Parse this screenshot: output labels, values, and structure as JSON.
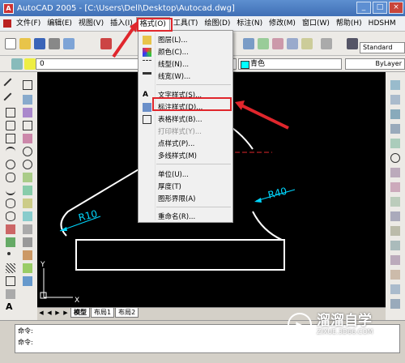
{
  "window": {
    "title": "AutoCAD 2005 - [C:\\Users\\Dell\\Desktop\\Autocad.dwg]",
    "controls": [
      "_",
      "□",
      "×"
    ]
  },
  "menubar": {
    "items": [
      "文件(F)",
      "编辑(E)",
      "视图(V)",
      "插入(I)",
      "格式(O)",
      "工具(T)",
      "绘图(D)",
      "标注(N)",
      "修改(M)",
      "窗口(W)",
      "帮助(H)",
      "HDSHM"
    ],
    "active_index": 4
  },
  "toolbar": {
    "style_value": "Standard",
    "layer_value": "0",
    "color_value": "青色",
    "linetype_value": "ByLayer"
  },
  "format_menu": {
    "items": [
      {
        "label": "图层(L)...",
        "enabled": true
      },
      {
        "label": "颜色(C)...",
        "enabled": true
      },
      {
        "label": "线型(N)...",
        "enabled": true
      },
      {
        "label": "线宽(W)...",
        "enabled": true
      },
      {
        "label": "文字样式(S)...",
        "enabled": true
      },
      {
        "label": "标注样式(D)...",
        "enabled": true
      },
      {
        "label": "表格样式(B)...",
        "enabled": true
      },
      {
        "label": "打印样式(Y)...",
        "enabled": false
      },
      {
        "label": "点样式(P)...",
        "enabled": true
      },
      {
        "label": "多线样式(M)",
        "enabled": true
      },
      {
        "label": "单位(U)...",
        "enabled": true
      },
      {
        "label": "厚度(T)",
        "enabled": true
      },
      {
        "label": "图形界限(A)",
        "enabled": true
      },
      {
        "label": "重命名(R)...",
        "enabled": true
      }
    ],
    "highlighted_index": 5
  },
  "drawing": {
    "dim_left": "R10",
    "dim_right": "R40",
    "ucs_x": "X",
    "ucs_y": "Y"
  },
  "layout_tabs": {
    "items": [
      "模型",
      "布局1",
      "布局2"
    ],
    "active_index": 0
  },
  "command": {
    "lines": [
      "命令:",
      "命令:"
    ]
  },
  "watermark": {
    "name": "溜溜自学",
    "domain": "ZIXUE.3D66.COM"
  },
  "colors": {
    "highlight_red": "#e0262c",
    "drawing_white": "#ffffff",
    "dimension_cyan": "#00d7ff",
    "canvas_black": "#000000"
  }
}
